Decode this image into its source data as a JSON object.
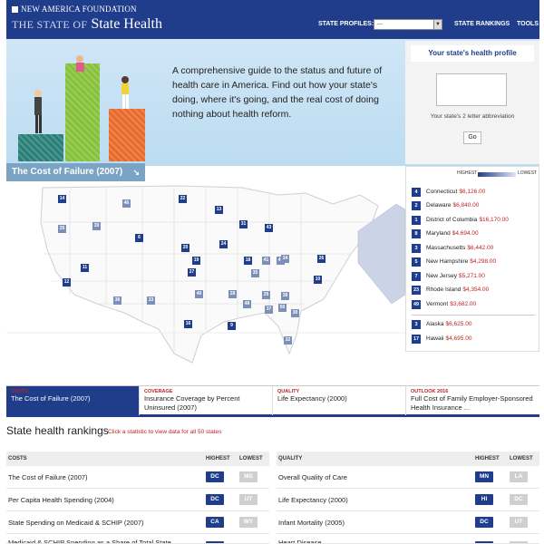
{
  "header": {
    "org": "NEW AMERICA FOUNDATION",
    "title_prefix": "THE STATE OF",
    "title_main": "State Health",
    "profiles_label": "STATE PROFILES:",
    "profiles_selected": "---",
    "nav_rankings": "STATE RANKINGS",
    "nav_tools": "TOOLS",
    "brand_color": "#1f3d8a"
  },
  "hero": {
    "text": "A comprehensive guide to the status and future of health care in America. Find out how your state's doing, where it's going, and the real cost of doing nothing about health reform."
  },
  "profile": {
    "title": "Your state's health profile",
    "input_label": "Your state's 2 letter abbreviation",
    "go_label": "Go"
  },
  "map": {
    "tab_label": "The Cost of Failure (2007)",
    "tab_arrow": "↘",
    "badges": [
      {
        "n": "14",
        "dark": true
      },
      {
        "n": "46",
        "dark": false
      },
      {
        "n": "22",
        "dark": true
      },
      {
        "n": "13",
        "dark": true
      },
      {
        "n": "25",
        "dark": false
      },
      {
        "n": "39",
        "dark": false
      },
      {
        "n": "31",
        "dark": true
      },
      {
        "n": "43",
        "dark": true
      },
      {
        "n": "6",
        "dark": true
      },
      {
        "n": "20",
        "dark": true
      },
      {
        "n": "24",
        "dark": true
      },
      {
        "n": "19",
        "dark": true
      },
      {
        "n": "18",
        "dark": true
      },
      {
        "n": "11",
        "dark": true
      },
      {
        "n": "41",
        "dark": false
      },
      {
        "n": "47",
        "dark": false
      },
      {
        "n": "34",
        "dark": false
      },
      {
        "n": "26",
        "dark": true
      },
      {
        "n": "12",
        "dark": true
      },
      {
        "n": "27",
        "dark": true
      },
      {
        "n": "35",
        "dark": false
      },
      {
        "n": "10",
        "dark": true
      },
      {
        "n": "29",
        "dark": false
      },
      {
        "n": "38",
        "dark": false
      },
      {
        "n": "36",
        "dark": false
      },
      {
        "n": "33",
        "dark": false
      },
      {
        "n": "40",
        "dark": false
      },
      {
        "n": "28",
        "dark": false
      },
      {
        "n": "48",
        "dark": false
      },
      {
        "n": "16",
        "dark": true
      },
      {
        "n": "9",
        "dark": true
      },
      {
        "n": "37",
        "dark": false
      },
      {
        "n": "50",
        "dark": false
      },
      {
        "n": "30",
        "dark": false
      },
      {
        "n": "32",
        "dark": false
      }
    ]
  },
  "legend": {
    "highest": "HIGHEST",
    "lowest": "LOWEST",
    "items": [
      {
        "rank": "4",
        "state": "Connecticut",
        "value": "$6,126.00"
      },
      {
        "rank": "2",
        "state": "Delaware",
        "value": "$6,840.00"
      },
      {
        "rank": "1",
        "state": "District of Columbia",
        "value": "$16,170.00"
      },
      {
        "rank": "8",
        "state": "Maryland",
        "value": "$4,694.00"
      },
      {
        "rank": "3",
        "state": "Massachusetts",
        "value": "$6,442.00"
      },
      {
        "rank": "5",
        "state": "New Hampshire",
        "value": "$4,298.00"
      },
      {
        "rank": "7",
        "state": "New Jersey",
        "value": "$5,271.00"
      },
      {
        "rank": "23",
        "state": "Rhode Island",
        "value": "$4,354.00"
      },
      {
        "rank": "49",
        "state": "Vermont",
        "value": "$3,682.00"
      },
      {
        "rank": "3",
        "state": "Alaska",
        "value": "$6,625.00"
      },
      {
        "rank": "17",
        "state": "Hawaii",
        "value": "$4,695.00"
      }
    ]
  },
  "categories": [
    {
      "cat": "COSTS",
      "label": "The Cost of Failure (2007)"
    },
    {
      "cat": "COVERAGE",
      "label": "Insurance Coverage by Percent Uninsured (2007)"
    },
    {
      "cat": "QUALITY",
      "label": "Life Expectancy (2000)"
    },
    {
      "cat": "OUTLOOK 2016",
      "label": "Full Cost of Family Employer-Sponsored Health Insurance ..."
    }
  ],
  "rankings": {
    "title": "State health rankings",
    "hint": "Click a statistic to view data for all 50 states",
    "costs": {
      "head": "COSTS",
      "highest": "HIGHEST",
      "lowest": "LOWEST",
      "rows": [
        {
          "name": "The Cost of Failure (2007)",
          "hi": "DC",
          "lo": "MS"
        },
        {
          "name": "Per Capita Health Spending (2004)",
          "hi": "DC",
          "lo": "UT"
        },
        {
          "name": "State Spending on Medicaid & SCHIP (2007)",
          "hi": "CA",
          "lo": "WY"
        },
        {
          "name": "Medicaid & SCHIP Spending as a Share of Total State",
          "hi": "",
          "lo": ""
        }
      ]
    },
    "quality": {
      "head": "QUALITY",
      "highest": "HIGHEST",
      "lowest": "LOWEST",
      "rows": [
        {
          "name": "Overall Quality of Care",
          "hi": "MN",
          "lo": "LA"
        },
        {
          "name": "Life Expectancy (2000)",
          "hi": "HI",
          "lo": "DC"
        },
        {
          "name": "Infant Mortality (2005)",
          "hi": "DC",
          "lo": "UT"
        },
        {
          "name": "Heart Disease",
          "hi": "WV",
          "lo": "DC"
        }
      ]
    }
  }
}
